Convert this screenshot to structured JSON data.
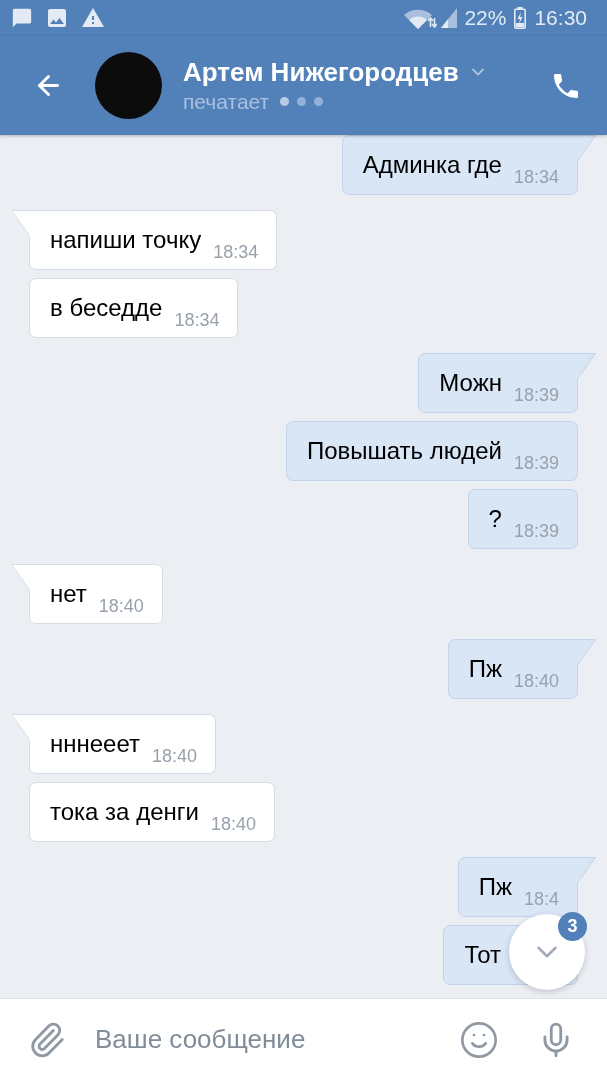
{
  "status_bar": {
    "battery_percent": "22%",
    "time": "16:30"
  },
  "header": {
    "title": "Артем Нижегородцев",
    "status": "печатает"
  },
  "messages": [
    {
      "kind": "outgoing",
      "text": "Админка где",
      "time": "18:34"
    },
    {
      "kind": "incoming",
      "text": "напиши точку",
      "time": "18:34"
    },
    {
      "kind": "incoming",
      "text": "в беседде",
      "time": "18:34"
    },
    {
      "kind": "outgoing",
      "text": "Можн",
      "time": "18:39"
    },
    {
      "kind": "outgoing",
      "text": "Повышать людей",
      "time": "18:39"
    },
    {
      "kind": "outgoing",
      "text": "?",
      "time": "18:39"
    },
    {
      "kind": "incoming",
      "text": "нет",
      "time": "18:40"
    },
    {
      "kind": "outgoing",
      "text": "Пж",
      "time": "18:40"
    },
    {
      "kind": "incoming",
      "text": "нннееет",
      "time": "18:40"
    },
    {
      "kind": "incoming",
      "text": "тока за денги",
      "time": "18:40"
    },
    {
      "kind": "outgoing",
      "text": "Пж",
      "time": "18:4"
    },
    {
      "kind": "outgoing",
      "text": "Тот"
    }
  ],
  "scroll_down_button": {
    "badge": "3"
  },
  "composer": {
    "placeholder": "Ваше сообщение"
  }
}
